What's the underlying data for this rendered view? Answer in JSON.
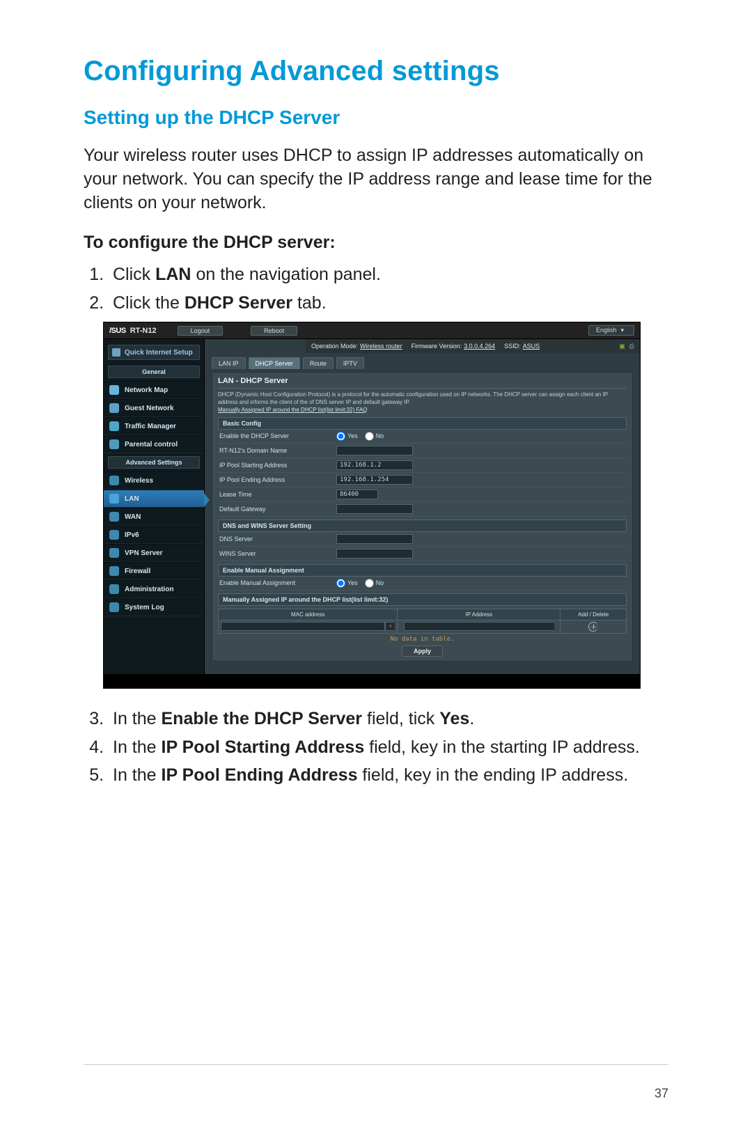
{
  "heading": "Configuring Advanced settings",
  "subheading": "Setting up the DHCP Server",
  "intro": "Your wireless router uses DHCP to assign IP addresses automatically on your network. You can specify the IP address range and lease time for the clients on your network.",
  "steps_title": "To configure the DHCP server:",
  "steps": {
    "1_pre": "Click ",
    "1_b": "LAN",
    "1_post": " on the navigation panel.",
    "2_pre": "Click the ",
    "2_b": "DHCP Server",
    "2_post": " tab.",
    "3_pre": "In the ",
    "3_b": "Enable the DHCP Server",
    "3_mid": " field, tick ",
    "3_b2": "Yes",
    "3_post": ".",
    "4_pre": "In the ",
    "4_b": "IP Pool Starting Address",
    "4_post": " field, key in the starting IP address.",
    "5_pre": "In the ",
    "5_b": "IP Pool Ending Address",
    "5_post": " field, key in the ending IP address."
  },
  "page_number": "37",
  "router": {
    "brand": "/SUS",
    "model": "RT-N12",
    "logout": "Logout",
    "reboot": "Reboot",
    "language": "English",
    "status": {
      "opmode_label": "Operation Mode:",
      "opmode_value": "Wireless router",
      "fw_label": "Firmware Version:",
      "fw_value": "3.0.0.4.264",
      "ssid_label": "SSID:",
      "ssid_value": "ASUS"
    },
    "sidebar": {
      "qis": "Quick Internet Setup",
      "general": "General",
      "advanced": "Advanced Settings",
      "items_general": [
        "Network Map",
        "Guest Network",
        "Traffic Manager",
        "Parental control"
      ],
      "items_advanced": [
        "Wireless",
        "LAN",
        "WAN",
        "IPv6",
        "VPN Server",
        "Firewall",
        "Administration",
        "System Log"
      ]
    },
    "tabs": [
      "LAN IP",
      "DHCP Server",
      "Route",
      "IPTV"
    ],
    "panel_title": "LAN - DHCP Server",
    "panel_desc": "DHCP (Dynamic Host Configuration Protocol) is a protocol for the automatic configuration used on IP networks. The DHCP server can assign each client an IP address and informs the client of the of DNS server IP and default gateway IP.",
    "panel_faqlink": "Manually Assigned IP around the DHCP list(list limit:32) FAQ",
    "sections": {
      "basic": "Basic Config",
      "dns": "DNS and WINS Server Setting",
      "manual": "Enable Manual Assignment",
      "manual_list": "Manually Assigned IP around the DHCP list(list limit:32)"
    },
    "fields": {
      "enable": "Enable the DHCP Server",
      "domain": "RT-N12's Domain Name",
      "start": "IP Pool Starting Address",
      "start_val": "192.168.1.2",
      "end": "IP Pool Ending Address",
      "end_val": "192.168.1.254",
      "lease": "Lease Time",
      "lease_val": "86400",
      "gateway": "Default Gateway",
      "dns": "DNS Server",
      "wins": "WINS Server",
      "manual_enable": "Enable Manual Assignment"
    },
    "radio": {
      "yes": "Yes",
      "no": "No"
    },
    "table": {
      "mac": "MAC address",
      "ip": "IP Address",
      "act": "Add / Delete",
      "nodata": "No data in table."
    },
    "apply": "Apply"
  }
}
